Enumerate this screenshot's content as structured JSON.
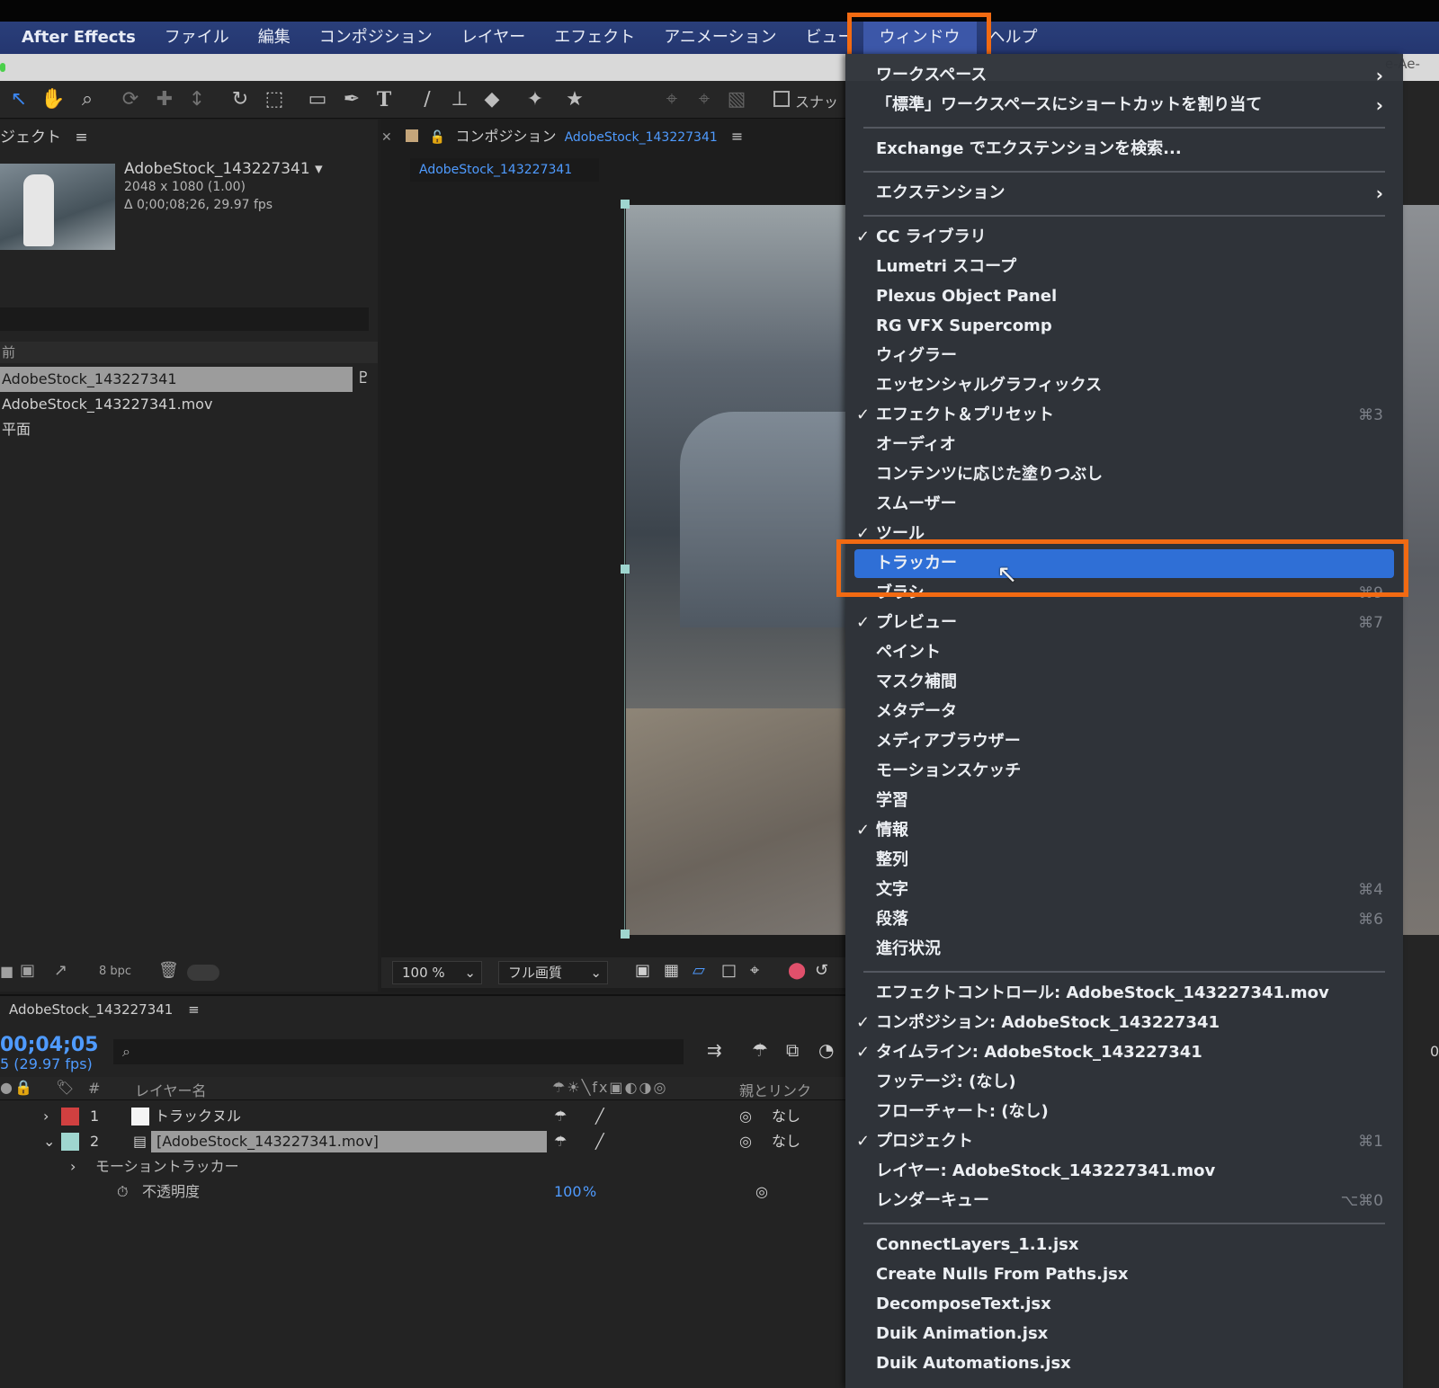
{
  "menubar": {
    "items": [
      "After Effects",
      "ファイル",
      "編集",
      "コンポジション",
      "レイヤー",
      "エフェクト",
      "アニメーション",
      "ビュー",
      "ウィンドウ",
      "ヘルプ"
    ],
    "active": "ウィンドウ"
  },
  "strip": {
    "right_text": "e-Ae-"
  },
  "toolbar": {
    "snap_label": "スナッ"
  },
  "project": {
    "title_partial": "ジェクト",
    "item_name": "AdobeStock_143227341",
    "item_res": "2048 x 1080 (1.00)",
    "item_dur": "Δ 0;00;08;26, 29.97 fps",
    "col_header_partial": "前",
    "rows": [
      "AdobeStock_143227341",
      "AdobeStock_143227341.mov",
      "平面"
    ],
    "bpc": "8 bpc"
  },
  "comp": {
    "label": "コンポジション",
    "name": "AdobeStock_143227341",
    "tab": "AdobeStock_143227341",
    "zoom": "100 %",
    "quality": "フル画質"
  },
  "timeline": {
    "title": "AdobeStock_143227341",
    "time": "00;04;05",
    "fps": "5 (29.97 fps)",
    "col_layer_name": "レイヤー名",
    "col_parent": "親とリンク",
    "col_hash": "#",
    "rows": [
      {
        "num": "1",
        "name": "トラックヌル",
        "parent": "なし",
        "color": "#d04040"
      },
      {
        "num": "2",
        "name": "[AdobeStock_143227341.mov]",
        "parent": "なし",
        "color": "#9fd6cf"
      }
    ],
    "sub_motion": "モーショントラッカー",
    "opacity_label": "不透明度",
    "opacity_value": "100",
    "opacity_unit": "%",
    "right_digit": "0"
  },
  "window_menu": {
    "items": [
      {
        "label": "ワークスペース",
        "arrow": true
      },
      {
        "label": "「標準」ワークスペースにショートカットを割り当て",
        "arrow": true
      },
      {
        "sep": true
      },
      {
        "label": "Exchange でエクステンションを検索..."
      },
      {
        "sep": true
      },
      {
        "label": "エクステンション",
        "arrow": true
      },
      {
        "sep": true
      },
      {
        "label": "CC ライブラリ",
        "check": true
      },
      {
        "label": "Lumetri スコープ"
      },
      {
        "label": "Plexus Object Panel"
      },
      {
        "label": "RG VFX Supercomp"
      },
      {
        "label": "ウィグラー"
      },
      {
        "label": "エッセンシャルグラフィックス"
      },
      {
        "label": "エフェクト＆プリセット",
        "check": true,
        "shortcut": "⌘3"
      },
      {
        "label": "オーディオ"
      },
      {
        "label": "コンテンツに応じた塗りつぶし"
      },
      {
        "label": "スムーザー"
      },
      {
        "label": "ツール",
        "check": true
      },
      {
        "label": "トラッカー",
        "highlight": true
      },
      {
        "label": "ブラシ",
        "shortcut": "⌘9"
      },
      {
        "label": "プレビュー",
        "check": true,
        "shortcut": "⌘7"
      },
      {
        "label": "ペイント"
      },
      {
        "label": "マスク補間"
      },
      {
        "label": "メタデータ"
      },
      {
        "label": "メディアブラウザー"
      },
      {
        "label": "モーションスケッチ"
      },
      {
        "label": "学習"
      },
      {
        "label": "情報",
        "check": true
      },
      {
        "label": "整列"
      },
      {
        "label": "文字",
        "shortcut": "⌘4"
      },
      {
        "label": "段落",
        "shortcut": "⌘6"
      },
      {
        "label": "進行状況"
      },
      {
        "sep": true
      },
      {
        "label": "エフェクトコントロール: AdobeStock_143227341.mov"
      },
      {
        "label": "コンポジション: AdobeStock_143227341",
        "check": true
      },
      {
        "label": "タイムライン: AdobeStock_143227341",
        "check": true
      },
      {
        "label": "フッテージ: (なし)"
      },
      {
        "label": "フローチャート: (なし)"
      },
      {
        "label": "プロジェクト",
        "check": true,
        "shortcut": "⌘1"
      },
      {
        "label": "レイヤー: AdobeStock_143227341.mov"
      },
      {
        "label": "レンダーキュー",
        "shortcut": "⌥⌘0"
      },
      {
        "sep": true
      },
      {
        "label": "ConnectLayers_1.1.jsx"
      },
      {
        "label": "Create Nulls From Paths.jsx"
      },
      {
        "label": "DecomposeText.jsx"
      },
      {
        "label": "Duik Animation.jsx"
      },
      {
        "label": "Duik Automations.jsx"
      }
    ]
  },
  "colors": {
    "accent_orange": "#f26a12",
    "highlight_blue": "#2f6fd6",
    "menubar_blue": "#2a3f7a",
    "text_blue": "#4f9bff"
  }
}
